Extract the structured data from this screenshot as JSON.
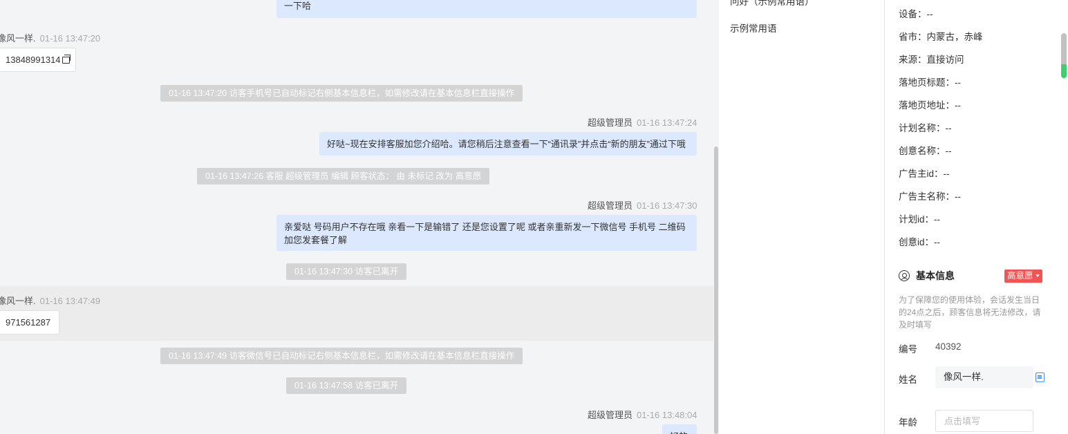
{
  "chat": {
    "msg1_text": "一下哈",
    "visitor_name": "像风一样.",
    "visitor_time_1": "01-16 13:47:20",
    "visitor_msg_1": "13848991314",
    "sys_1": "01-16 13:47:20 访客手机号已自动标记右侧基本信息栏，如需修改请在基本信息栏直接操作",
    "agent_name": "超级管理员",
    "agent_time_1": "01-16 13:47:24",
    "agent_msg_1": "好哒~现在安排客服加您介绍哈。请您稍后注意查看一下“通讯录”并点击“新的朋友”通过下哦",
    "sys_2": "01-16 13:47:26 客服 超级管理员 编辑 顾客状态： 由 未标记 改为 高意愿",
    "agent_time_2": "01-16 13:47:30",
    "agent_msg_2_line1": "亲爱哒 号码用户不存在哦 亲看一下是输错了 还是您设置了呢 或者亲重新发一下微信号 手机号 二维码",
    "agent_msg_2_line2": "加您发套餐了解",
    "sys_3": "01-16 13:47:30 访客已离开",
    "visitor_time_2": "01-16 13:47:49",
    "visitor_msg_2": "971561287",
    "sys_4": "01-16 13:47:49 访客微信号已自动标记右侧基本信息栏，如需修改请在基本信息栏直接操作",
    "sys_5": "01-16 13:47:58 访客已离开",
    "agent_time_3": "01-16 13:48:04",
    "agent_msg_3": "好的"
  },
  "phrases": {
    "item_1": "问好（示例常用语）",
    "item_2": "示例常用语"
  },
  "info": {
    "rows": [
      {
        "label": "设备：",
        "value": "--"
      },
      {
        "label": "省市：",
        "value": "内蒙古，赤峰"
      },
      {
        "label": "来源：",
        "value": "直接访问"
      },
      {
        "label": "落地页标题：",
        "value": "--"
      },
      {
        "label": "落地页地址：",
        "value": "--"
      },
      {
        "label": "计划名称：",
        "value": "--"
      },
      {
        "label": "创意名称：",
        "value": "--"
      },
      {
        "label": "广告主id：",
        "value": "--"
      },
      {
        "label": "广告主名称：",
        "value": "--"
      },
      {
        "label": "计划id：",
        "value": "--"
      },
      {
        "label": "创意id：",
        "value": "--"
      }
    ],
    "section_title": "基本信息",
    "status_badge": "高意愿",
    "notice": "为了保障您的使用体验，会话发生当日的24点之后，顾客信息将无法修改，请及时填写",
    "id_label": "编号",
    "id_value": "40392",
    "name_label": "姓名",
    "name_value": "像风一样.",
    "age_label": "年龄",
    "age_placeholder": "点击填写"
  },
  "colors": {
    "outgoing_bubble": "#dbe8fd",
    "system_notice": "#d4d4d4",
    "status_badge": "#f05555",
    "copy_icon": "#4a8ff7"
  }
}
